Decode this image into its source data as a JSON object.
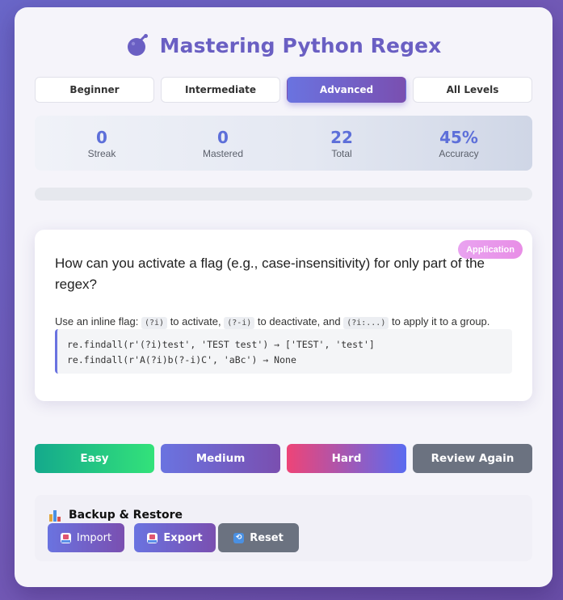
{
  "header": {
    "title": "Mastering Python Regex",
    "icon": "bomb-icon"
  },
  "levels": [
    {
      "label": "Beginner",
      "active": false
    },
    {
      "label": "Intermediate",
      "active": false
    },
    {
      "label": "Advanced",
      "active": true
    },
    {
      "label": "All Levels",
      "active": false
    }
  ],
  "stats": [
    {
      "value": "0",
      "label": "Streak"
    },
    {
      "value": "0",
      "label": "Mastered"
    },
    {
      "value": "22",
      "label": "Total"
    },
    {
      "value": "45%",
      "label": "Accuracy"
    }
  ],
  "progress": {
    "percent": 0
  },
  "card": {
    "badge": "Application",
    "question": "How can you activate a flag (e.g., case-insensitivity) for only part of the regex?",
    "answer": {
      "prefix": "Use an inline flag:",
      "code1": "(?i)",
      "mid1": "to activate,",
      "code2": "(?-i)",
      "mid2": "to deactivate, and",
      "code3": "(?i:...)",
      "suffix": "to apply it to a group."
    },
    "code_lines": [
      "re.findall(r'(?i)test', 'TEST test') → ['TEST', 'test']",
      "re.findall(r'A(?i)b(?-i)C', 'aBc') → None"
    ]
  },
  "difficulty": {
    "easy": "Easy",
    "medium": "Medium",
    "hard": "Hard",
    "review": "Review Again"
  },
  "backup": {
    "title": "Backup & Restore",
    "import": "Import",
    "export": "Export",
    "reset": "Reset"
  },
  "colors": {
    "accent": "#6a73e0",
    "easy": "#19c27e",
    "hard": "#e6457a",
    "review": "#6b7280"
  }
}
